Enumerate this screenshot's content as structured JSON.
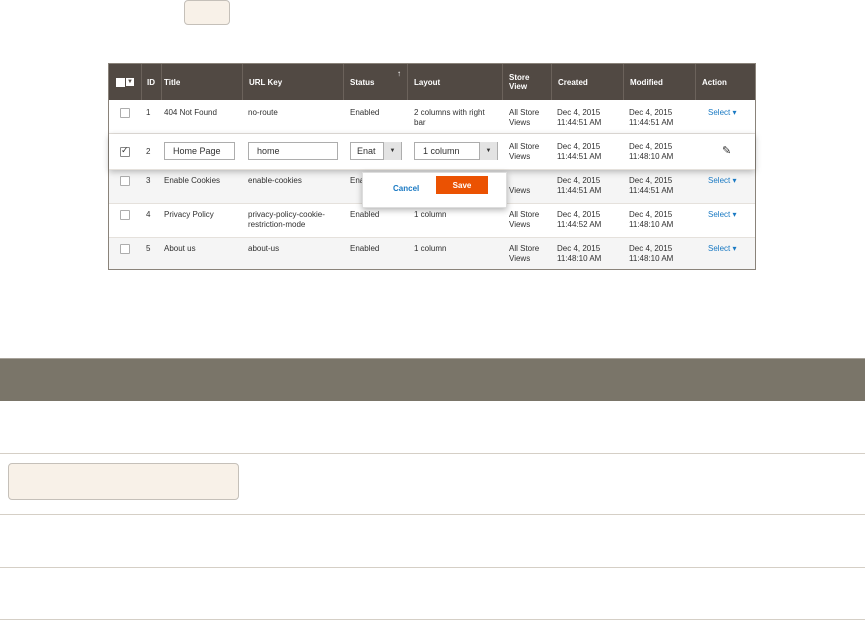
{
  "grid": {
    "columns": {
      "id": "ID",
      "title": "Title",
      "url_key": "URL Key",
      "status": "Status",
      "layout": "Layout",
      "store_view": [
        "Store",
        "View"
      ],
      "created": "Created",
      "modified": "Modified",
      "action": "Action"
    },
    "sort_indicator": "↑",
    "rows": [
      {
        "id": "1",
        "title": "404 Not Found",
        "url_key": "no-route",
        "status": "Enabled",
        "layout": [
          "2 columns with right",
          "bar"
        ],
        "store_view": [
          "All Store",
          "Views"
        ],
        "created": [
          "Dec 4, 2015",
          "11:44:51 AM"
        ],
        "modified": [
          "Dec 4, 2015",
          "11:44:51 AM"
        ],
        "action": "Select"
      },
      {
        "id": "2",
        "title": "Home Page",
        "url_key": "home",
        "status": "Enat",
        "layout": "1 column",
        "store_view": [
          "All Store",
          "Views"
        ],
        "created": [
          "Dec 4, 2015",
          "11:44:51 AM"
        ],
        "modified": [
          "Dec 4, 2015",
          "11:48:10 AM"
        ],
        "checked": true
      },
      {
        "id": "3",
        "title": "Enable Cookies",
        "url_key": "enable-cookies",
        "status": "Ena",
        "layout": "",
        "store_view": [
          "Views",
          ""
        ],
        "created": [
          "Dec 4, 2015",
          "11:44:51 AM"
        ],
        "modified": [
          "Dec 4, 2015",
          "11:44:51 AM"
        ],
        "action": "Select"
      },
      {
        "id": "4",
        "title": "Privacy Policy",
        "url_key": [
          "privacy-policy-cookie-",
          "restriction-mode"
        ],
        "status": "Enabled",
        "layout": "1 column",
        "store_view": [
          "All Store",
          "Views"
        ],
        "created": [
          "Dec 4, 2015",
          "11:44:52 AM"
        ],
        "modified": [
          "Dec 4, 2015",
          "11:48:10 AM"
        ],
        "action": "Select"
      },
      {
        "id": "5",
        "title": "About us",
        "url_key": "about-us",
        "status": "Enabled",
        "layout": "1 column",
        "store_view": [
          "All Store",
          "Views"
        ],
        "created": [
          "Dec 4, 2015",
          "11:48:10 AM"
        ],
        "modified": [
          "Dec 4, 2015",
          "11:48:10 AM"
        ],
        "action": "Select"
      }
    ]
  },
  "inline_edit": {
    "cancel_label": "Cancel",
    "save_label": "Save"
  },
  "colors": {
    "header_bg": "#514943",
    "save_bg": "#eb5202",
    "link": "#1979c3",
    "table_bar": "#7a7569"
  }
}
